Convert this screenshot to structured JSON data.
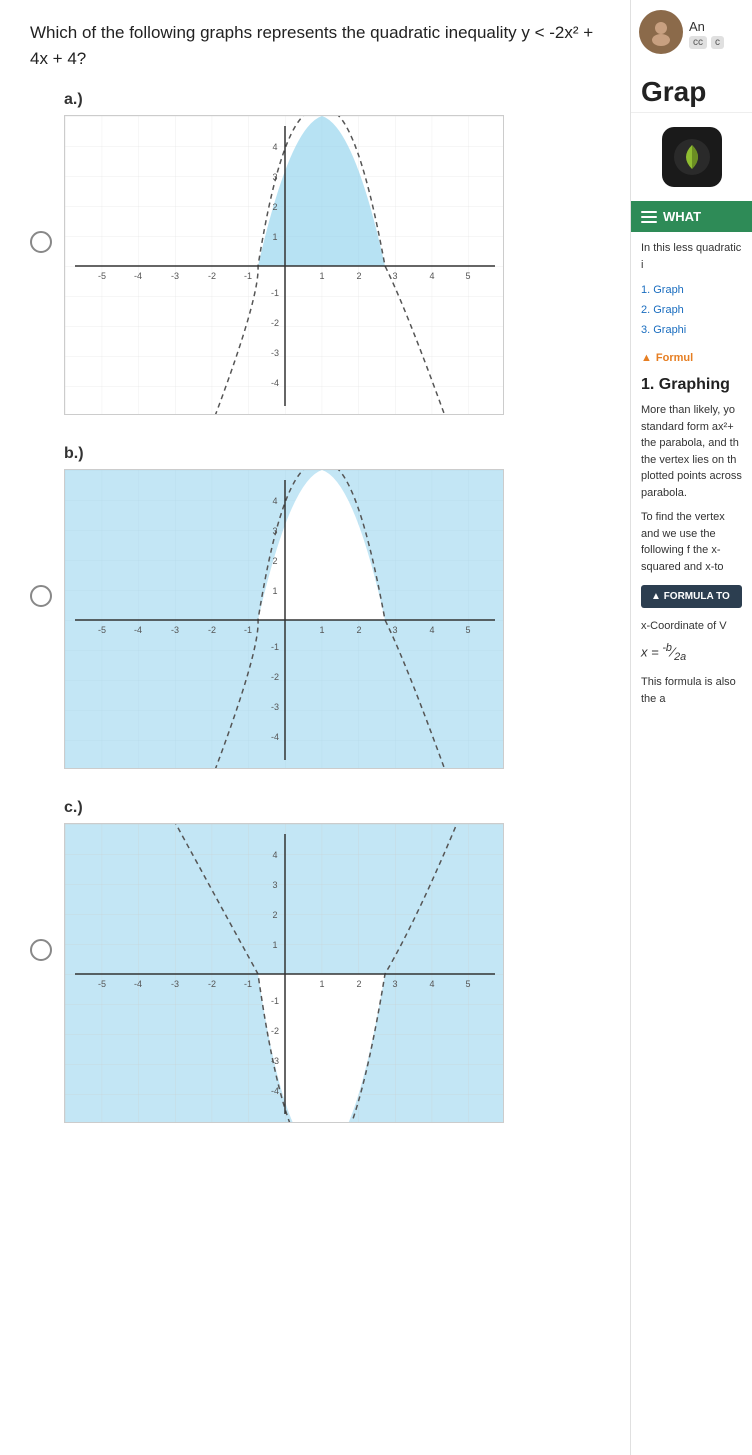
{
  "question": {
    "text": "Which of the following graphs represents the quadratic inequality y < -2x² + 4x + 4?"
  },
  "options": [
    {
      "id": "a",
      "label": "a.)",
      "selected": false
    },
    {
      "id": "b",
      "label": "b.)",
      "selected": false
    },
    {
      "id": "c",
      "label": "c.)",
      "selected": false
    }
  ],
  "sidebar": {
    "app_title": "Grap",
    "user_name": "An",
    "badges": [
      "cc",
      "c"
    ],
    "section_header": "WHAT",
    "intro_text": "In this less quadratic i",
    "list_items": [
      "1. Graph",
      "2. Graph",
      "3. Graphi"
    ],
    "formula_label": "Formul",
    "heading_1": "1. Graphing",
    "body_text_1": "More than likely, yo standard form ax²+ the parabola, and th the vertex lies on th plotted points across parabola.",
    "body_text_2": "To find the vertex and we use the following f the x-squared and x-to",
    "formula_box_label": "FORMULA TO",
    "formula_caption": "x-Coordinate of V",
    "formula_math": "x = -b / 2a",
    "footer_text": "This formula is also the a"
  }
}
